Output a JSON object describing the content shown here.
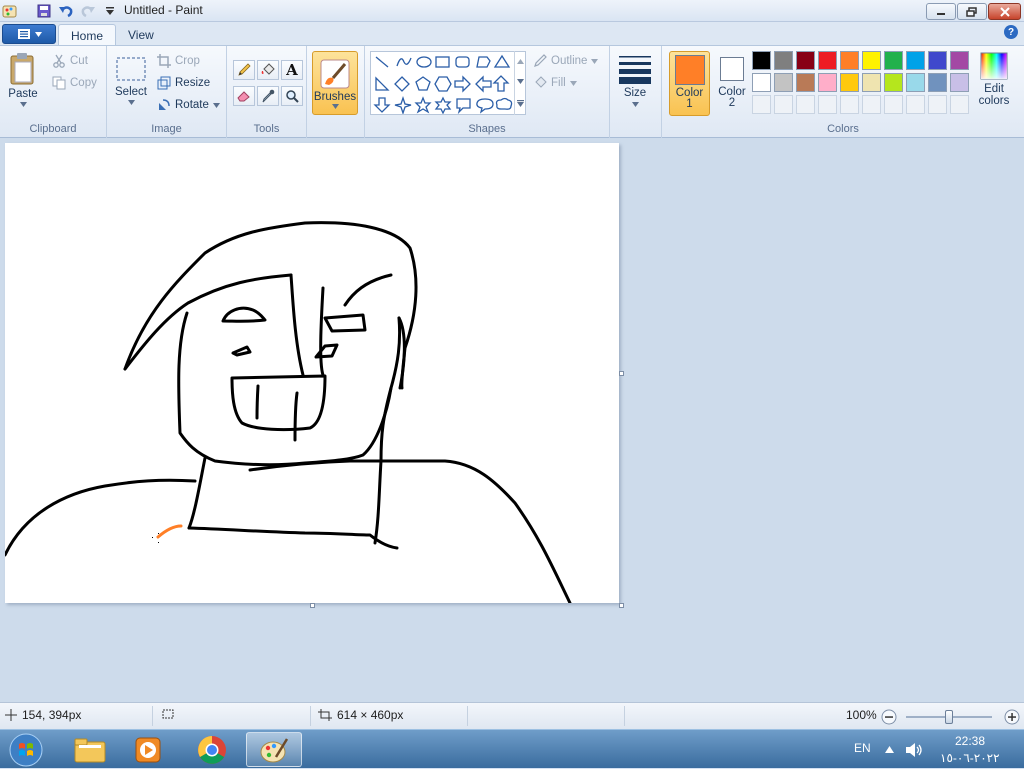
{
  "window": {
    "title": "Untitled - Paint",
    "min_icon": "minimize-icon",
    "max_icon": "restore-icon",
    "close_icon": "close-icon"
  },
  "quick_access": [
    "paint-app-icon",
    "save-icon",
    "undo-icon",
    "redo-icon",
    "customize-dropdown-icon"
  ],
  "tabs": [
    {
      "label": "Home",
      "active": true
    },
    {
      "label": "View",
      "active": false
    }
  ],
  "help_label": "?",
  "ribbon": {
    "clipboard": {
      "label": "Clipboard",
      "paste": "Paste",
      "cut": "Cut",
      "copy": "Copy"
    },
    "image": {
      "label": "Image",
      "select": "Select",
      "crop": "Crop",
      "resize": "Resize",
      "rotate": "Rotate"
    },
    "tools": {
      "label": "Tools",
      "items": [
        "pencil-icon",
        "fill-bucket-icon",
        "text-icon",
        "eraser-icon",
        "color-picker-icon",
        "magnifier-icon"
      ],
      "text_glyph": "A"
    },
    "brushes": {
      "label": "Brushes"
    },
    "shapes": {
      "label": "Shapes",
      "outline": "Outline",
      "fill": "Fill"
    },
    "size": {
      "label": "Size"
    },
    "colors": {
      "label": "Colors",
      "color1_label": "Color",
      "color1_num": "1",
      "color1_value": "#ff7f27",
      "color2_label": "Color",
      "color2_num": "2",
      "color2_value": "#ffffff",
      "edit_colors": "Edit colors",
      "edit_colors_line1": "Edit",
      "edit_colors_line2": "colors",
      "palette_row1": [
        "#000000",
        "#7f7f7f",
        "#880015",
        "#ed1c24",
        "#ff7f27",
        "#fff200",
        "#22b14c",
        "#00a2e8",
        "#3f48cc",
        "#a349a4"
      ],
      "palette_row2": [
        "#ffffff",
        "#c3c3c3",
        "#b97a57",
        "#ffaec9",
        "#ffc90e",
        "#efe4b0",
        "#b5e61d",
        "#99d9ea",
        "#7092be",
        "#c8bfe7"
      ]
    }
  },
  "status": {
    "cursor_pos": "154, 394px",
    "selection_size": "",
    "canvas_size": "614 × 460px",
    "zoom": "100%",
    "zoom_level": 1.0
  },
  "taskbar": {
    "apps": [
      "windows-explorer-icon",
      "media-player-icon",
      "chrome-icon",
      "paint-icon"
    ],
    "language": "EN",
    "time": "22:38",
    "date": "٢٠٢٢-٠٦-١٥"
  }
}
